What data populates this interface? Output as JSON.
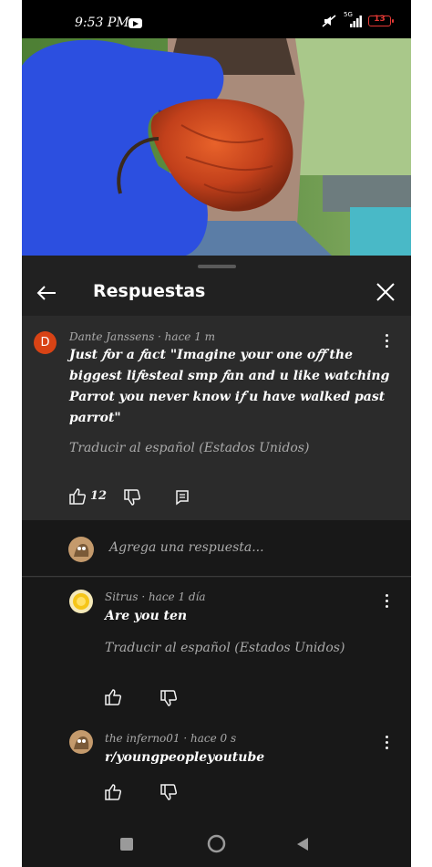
{
  "status_bar": {
    "time": "9:53 PM",
    "network": "5G",
    "battery": "13",
    "battery_color": "#e53935",
    "icons": [
      "youtube-notification-icon",
      "mute-icon",
      "signal-icon"
    ]
  },
  "video": {
    "description_icon": "video-thumbnail"
  },
  "sheet": {
    "title": "Respuestas",
    "back_icon": "arrow-left-icon",
    "close_icon": "close-icon"
  },
  "parent_comment": {
    "avatar_letter": "D",
    "avatar_color": "#d84315",
    "author_meta": "Dante Janssens · hace 1 m",
    "text_lines": [
      "Just 𝑓or a 𝑓act \"Imagine your one o𝑓𝑓 the",
      "biggest li𝑓esteal smp 𝑓an and u like watching",
      "Parrot you never know i𝑓 u have walked past",
      "parrot\""
    ],
    "translate": "Traducir al español (Estados Unidos)",
    "like_count": "12"
  },
  "reply_input": {
    "placeholder": "Agrega una respuesta..."
  },
  "replies": [
    {
      "author_meta": "Sitrus · hace 1 día",
      "text": "Are you ten",
      "translate": "Traducir al español (Estados Unidos)"
    },
    {
      "author_meta": "the in𝑓erno01 · hace 0 s",
      "text": "r/youngpeopleyoutube"
    }
  ],
  "colors": {
    "sheet_bg": "#212121",
    "highlight_bg": "#2b2b2b",
    "list_bg": "#181818",
    "text": "#f1f1f1",
    "secondary_text": "#aaaaaa"
  }
}
